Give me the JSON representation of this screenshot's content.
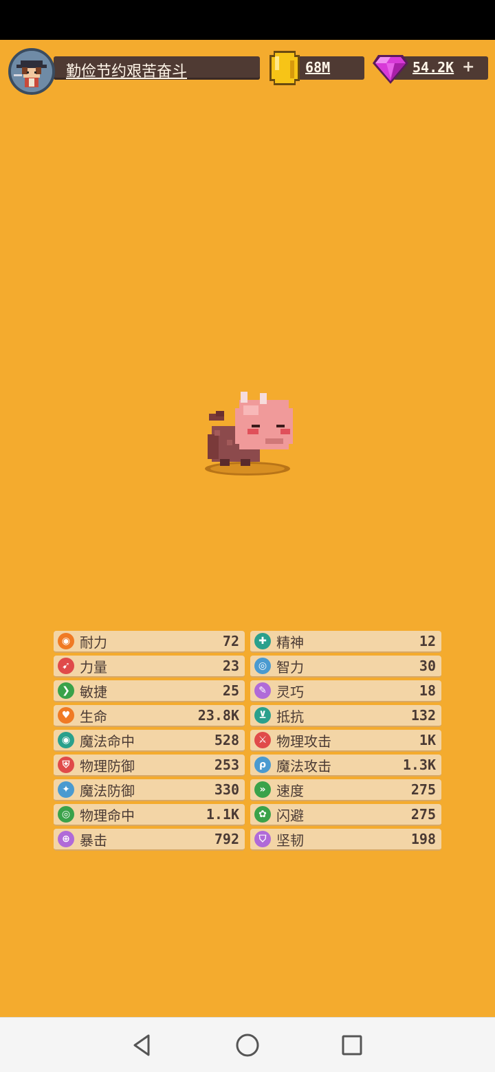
{
  "hud": {
    "player_name": "勤俭节约艰苦奋斗",
    "coins": "68M",
    "gems": "54.2K",
    "plus": "+"
  },
  "colors": {
    "background": "#f4ab2e",
    "bar": "#4f3a33",
    "stat_panel": "#f3d5a6"
  },
  "stats_left": [
    {
      "label": "耐力",
      "value": "72",
      "icon": "endurance-icon",
      "color": "#f07a24"
    },
    {
      "label": "力量",
      "value": "23",
      "icon": "strength-icon",
      "color": "#e04a4a"
    },
    {
      "label": "敏捷",
      "value": "25",
      "icon": "agility-icon",
      "color": "#3aa24a"
    },
    {
      "label": "生命",
      "value": "23.8K",
      "icon": "heart-icon",
      "color": "#f07a24"
    },
    {
      "label": "魔法命中",
      "value": "528",
      "icon": "magic-hit-icon",
      "color": "#2aa08c"
    },
    {
      "label": "物理防御",
      "value": "253",
      "icon": "physical-defense-icon",
      "color": "#e04a4a"
    },
    {
      "label": "魔法防御",
      "value": "330",
      "icon": "magic-defense-icon",
      "color": "#4a9ad0"
    },
    {
      "label": "物理命中",
      "value": "1.1K",
      "icon": "physical-hit-icon",
      "color": "#3aa24a"
    },
    {
      "label": "暴击",
      "value": "792",
      "icon": "crit-icon",
      "color": "#b06ad8"
    }
  ],
  "stats_right": [
    {
      "label": "精神",
      "value": "12",
      "icon": "spirit-icon",
      "color": "#2aa08c"
    },
    {
      "label": "智力",
      "value": "30",
      "icon": "intelligence-icon",
      "color": "#4a9ad0"
    },
    {
      "label": "灵巧",
      "value": "18",
      "icon": "dexterity-icon",
      "color": "#b06ad8"
    },
    {
      "label": "抵抗",
      "value": "132",
      "icon": "resistance-icon",
      "color": "#2aa08c"
    },
    {
      "label": "物理攻击",
      "value": "1K",
      "icon": "physical-attack-icon",
      "color": "#e04a4a"
    },
    {
      "label": "魔法攻击",
      "value": "1.3K",
      "icon": "magic-attack-icon",
      "color": "#4a9ad0"
    },
    {
      "label": "速度",
      "value": "275",
      "icon": "speed-icon",
      "color": "#3aa24a"
    },
    {
      "label": "闪避",
      "value": "275",
      "icon": "dodge-icon",
      "color": "#3aa24a"
    },
    {
      "label": "坚韧",
      "value": "198",
      "icon": "toughness-icon",
      "color": "#b06ad8"
    }
  ]
}
